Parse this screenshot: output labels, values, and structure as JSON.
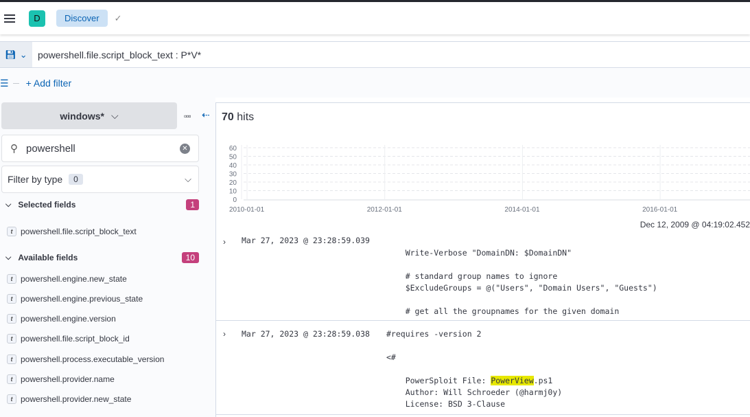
{
  "header": {
    "avatar_letter": "D",
    "breadcrumb": "Discover"
  },
  "query": {
    "text": "powershell.file.script_block_text : P*V*"
  },
  "filters": {
    "add_label": "+ Add filter"
  },
  "sidebar": {
    "index_pattern": "windows*",
    "search_value": "powershell",
    "filter_by_type_label": "Filter by type",
    "filter_by_type_count": "0",
    "selected_label": "Selected fields",
    "selected_count": "1",
    "selected_fields": [
      "powershell.file.script_block_text"
    ],
    "available_label": "Available fields",
    "available_count": "10",
    "available_fields": [
      "powershell.engine.new_state",
      "powershell.engine.previous_state",
      "powershell.engine.version",
      "powershell.file.script_block_id",
      "powershell.process.executable_version",
      "powershell.provider.name",
      "powershell.provider.new_state"
    ]
  },
  "main": {
    "hits_count": "70",
    "hits_label": "hits",
    "time_range_start": "Dec 12, 2009 @ 04:19:02.452"
  },
  "chart_data": {
    "type": "bar",
    "y_ticks": [
      "0",
      "10",
      "20",
      "30",
      "40",
      "50",
      "60"
    ],
    "x_ticks": [
      "2010-01-01",
      "2012-01-01",
      "2014-01-01",
      "2016-01-01"
    ],
    "ylim": [
      0,
      60
    ],
    "values": [],
    "grid": true
  },
  "documents": [
    {
      "timestamp": "Mar 27, 2023 @ 23:28:59.039",
      "lines": [
        "",
        "    Write-Verbose \"DomainDN: $DomainDN\"",
        "",
        "    # standard group names to ignore",
        "    $ExcludeGroups = @(\"Users\", \"Domain Users\", \"Guests\")",
        "",
        "    # get all the groupnames for the given domain"
      ]
    },
    {
      "timestamp": "Mar 27, 2023 @ 23:28:59.038",
      "first": "#requires -version 2",
      "lt": "<#",
      "pre_hl": "    PowerSploit File: ",
      "highlight": "PowerView",
      "post_hl": ".ps1",
      "lines": [
        "    Author: Will Schroeder (@harmj0y)",
        "    License: BSD 3-Clause"
      ]
    }
  ]
}
